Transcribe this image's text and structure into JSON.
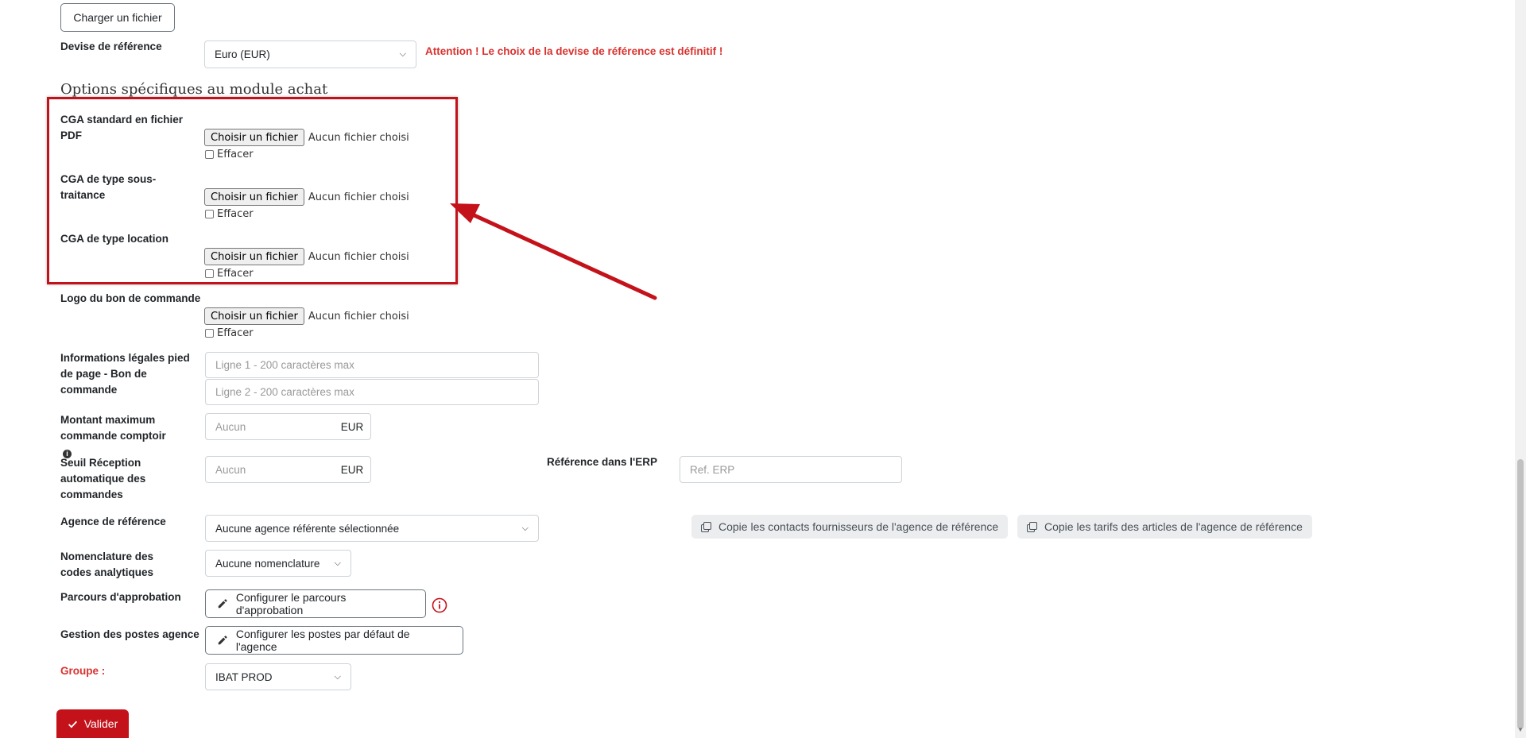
{
  "upload_file_button": "Charger un fichier",
  "currency": {
    "label": "Devise de référence",
    "value": "Euro (EUR)",
    "warning": "Attention ! Le choix de la devise de référence est définitif !"
  },
  "section_title": "Options spécifiques au module achat",
  "file_fields": [
    {
      "label": "CGA standard en fichier PDF",
      "button": "Choisir un fichier",
      "status": "Aucun fichier choisi",
      "clear": "Effacer"
    },
    {
      "label": "CGA de type sous-traitance",
      "button": "Choisir un fichier",
      "status": "Aucun fichier choisi",
      "clear": "Effacer"
    },
    {
      "label": "CGA de type location",
      "button": "Choisir un fichier",
      "status": "Aucun fichier choisi",
      "clear": "Effacer"
    },
    {
      "label": "Logo du bon de commande",
      "button": "Choisir un fichier",
      "status": "Aucun fichier choisi",
      "clear": "Effacer"
    }
  ],
  "legal_info": {
    "label": "Informations légales pied de page - Bon de commande",
    "line1_placeholder": "Ligne 1 - 200 caractères max",
    "line2_placeholder": "Ligne 2 - 200 caractères max"
  },
  "max_amount": {
    "label": "Montant maximum commande comptoir",
    "placeholder": "Aucun",
    "unit": "EUR"
  },
  "auto_reception": {
    "label": "Seuil Réception automatique des commandes",
    "placeholder": "Aucun",
    "unit": "EUR"
  },
  "erp_reference": {
    "label": "Référence dans l'ERP",
    "placeholder": "Ref. ERP"
  },
  "reference_agency": {
    "label": "Agence de référence",
    "value": "Aucune agence référente sélectionnée",
    "copy_contacts": "Copie les contacts fournisseurs de l'agence de référence",
    "copy_prices": "Copie les tarifs des articles de l'agence de référence"
  },
  "analytics": {
    "label": "Nomenclature des codes analytiques",
    "value": "Aucune nomenclature"
  },
  "approval": {
    "label": "Parcours d'approbation",
    "button": "Configurer le parcours d'approbation"
  },
  "posts": {
    "label": "Gestion des postes agence",
    "button": "Configurer les postes par défaut de l'agence"
  },
  "group": {
    "label": "Groupe :",
    "value": "IBAT PROD"
  },
  "submit": "Valider",
  "colors": {
    "accent": "#c4121a",
    "warning": "#d9322f",
    "highlight": "#c4121a"
  }
}
